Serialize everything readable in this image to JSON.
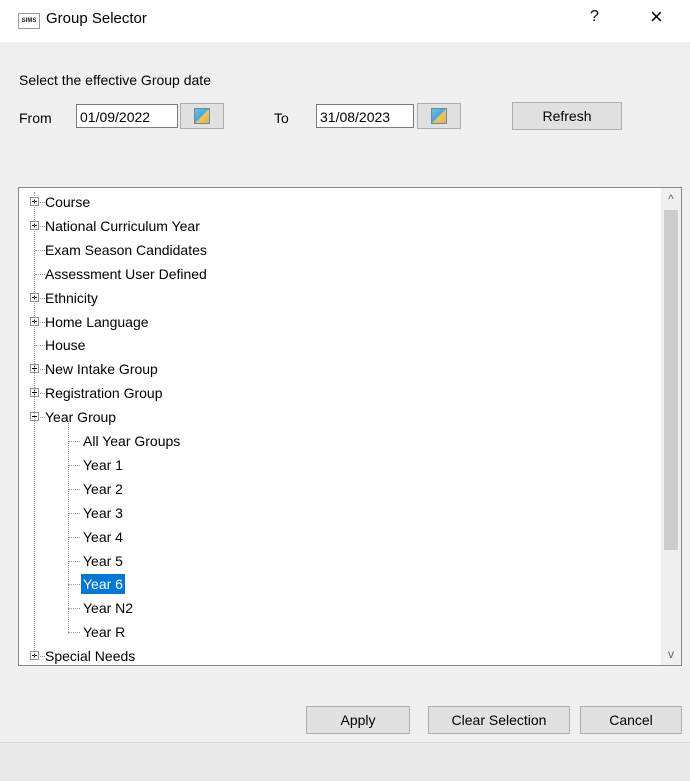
{
  "window": {
    "app_icon_text": "SIMS",
    "title": "Group Selector",
    "help": "?",
    "close": "×"
  },
  "dates": {
    "instruction": "Select the effective Group date",
    "from_label": "From",
    "from_value": "01/09/2022",
    "to_label": "To",
    "to_value": "31/08/2023",
    "refresh_label": "Refresh"
  },
  "tree": {
    "top_items": [
      {
        "label": "Course",
        "expander": "plus"
      },
      {
        "label": "National Curriculum Year",
        "expander": "plus"
      },
      {
        "label": "Exam Season Candidates",
        "expander": "none"
      },
      {
        "label": "Assessment User Defined",
        "expander": "none"
      },
      {
        "label": "Ethnicity",
        "expander": "plus"
      },
      {
        "label": "Home Language",
        "expander": "plus"
      },
      {
        "label": "House",
        "expander": "none"
      },
      {
        "label": "New Intake Group",
        "expander": "plus"
      },
      {
        "label": "Registration Group",
        "expander": "plus"
      },
      {
        "label": "Year Group",
        "expander": "minus"
      }
    ],
    "year_children": [
      {
        "label": "All Year Groups",
        "selected": false
      },
      {
        "label": "Year  1",
        "selected": false
      },
      {
        "label": "Year  2",
        "selected": false
      },
      {
        "label": "Year  3",
        "selected": false
      },
      {
        "label": "Year  4",
        "selected": false
      },
      {
        "label": "Year  5",
        "selected": false
      },
      {
        "label": "Year  6",
        "selected": true
      },
      {
        "label": "Year  N2",
        "selected": false
      },
      {
        "label": "Year  R",
        "selected": false
      }
    ],
    "after_items": [
      {
        "label": "Special Needs",
        "expander": "plus"
      }
    ],
    "scroll_up": "^",
    "scroll_down": "v"
  },
  "buttons": {
    "apply": "Apply",
    "clear": "Clear Selection",
    "cancel": "Cancel"
  },
  "colors": {
    "selection": "#0078d7"
  }
}
